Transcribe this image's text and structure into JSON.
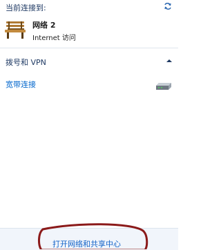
{
  "header": {
    "current_connection_label": "当前连接到:"
  },
  "network": {
    "name": "网络  2",
    "access": "Internet 访问"
  },
  "dialup": {
    "section_label": "拨号和 VPN",
    "items": [
      {
        "label": "宽带连接"
      }
    ]
  },
  "footer": {
    "open_center_label": "打开网络和共享中心"
  },
  "icons": {
    "refresh": "refresh-icon",
    "network": "bench-network-icon",
    "collapse": "chevron-up-icon",
    "modem": "modem-icon"
  },
  "colors": {
    "header_text": "#1e3963",
    "link": "#0066cc",
    "footer_bg": "#f1f5fb",
    "annotation": "#8b1a1a"
  }
}
